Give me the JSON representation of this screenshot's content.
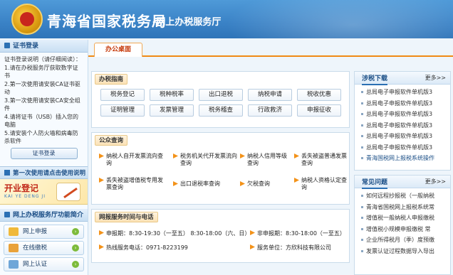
{
  "header": {
    "title": "青海省国家税务局",
    "subtitle": "-网上办税服务厅"
  },
  "sidebar": {
    "cert_login": {
      "heading": "证书登录",
      "intro": "证书登录说明（请仔细阅读）：",
      "steps": [
        "1.请在办税服务厅获取数字证书",
        "2.第一次使用请安装CA证书驱动",
        "3.第一次使用请安装CA安全组件",
        "4.请将证书（USB）插入您的电脑",
        "5.请安装个人防火墙和病毒防杀软件"
      ],
      "button": "证书登录"
    },
    "first_use": "第一次使用请点击使用说明",
    "promo": {
      "title": "开业登记",
      "tag": "KAI YE DENG JI"
    },
    "services_heading": "网上办税服务厅功能简介",
    "menu": [
      {
        "label": "网上申报",
        "icon": "folder-icon"
      },
      {
        "label": "在线缴税",
        "icon": "coins-icon"
      },
      {
        "label": "网上认证",
        "icon": "certificate-icon"
      }
    ]
  },
  "tabs": [
    {
      "label": "办公桌面",
      "active": true
    }
  ],
  "guide": {
    "title": "办税指南",
    "buttons": [
      "税务登记",
      "税种税率",
      "出口退税",
      "纳税申请",
      "税收优惠",
      "证明管理",
      "发票管理",
      "税务稽查",
      "行政救济",
      "申报征收"
    ]
  },
  "public_query": {
    "title": "公众查询",
    "items": [
      "纳税人自开发票流向查询",
      "税务机关代开发票流向查询",
      "纳税人信用等级查询",
      "丢失被盗普通发票查询",
      "丢失被盗增值税专用发票查询",
      "出口退税率查询",
      "欠税查询",
      "纳税人资格认定查询"
    ]
  },
  "service_info": {
    "title": "网报服务时间与电话",
    "lines": [
      {
        "label": "申报期：",
        "value": "8:30-19:30（一至五）  8:30-18:00（六、日）"
      },
      {
        "label": "非申报期：",
        "value": "8:30-18:00（一至五）"
      },
      {
        "label": "热线服务电话：",
        "value": "0971-8223199"
      },
      {
        "label": "服务单位：",
        "value": "方欣科技有限公司"
      }
    ]
  },
  "downloads": {
    "title": "涉税下载",
    "more": "更多>>",
    "items": [
      "总局电子申报软件单机版3",
      "总局电子申报软件单机版3",
      "总局电子申报软件单机版3",
      "总局电子申报软件单机版3",
      "总局电子申报软件单机版3",
      "总局电子申报软件单机版3",
      "青海国税网上报税系统操作"
    ]
  },
  "faq": {
    "title": "常见问题",
    "more": "更多>>",
    "items": [
      "如何远程抄报税（一般纳税",
      "青海省国税网上报税系统常",
      "增值税一般纳税人申报缴税",
      "增值税小规模申报缴税 常",
      "企业所得税月（季）度预缴",
      "发票认证过程数据导入导出"
    ]
  },
  "colors": {
    "header_blue": "#3a82c6",
    "accent_orange": "#f08a14",
    "active_tab_text": "#c63a0b",
    "link_blue": "#1a4e86"
  }
}
